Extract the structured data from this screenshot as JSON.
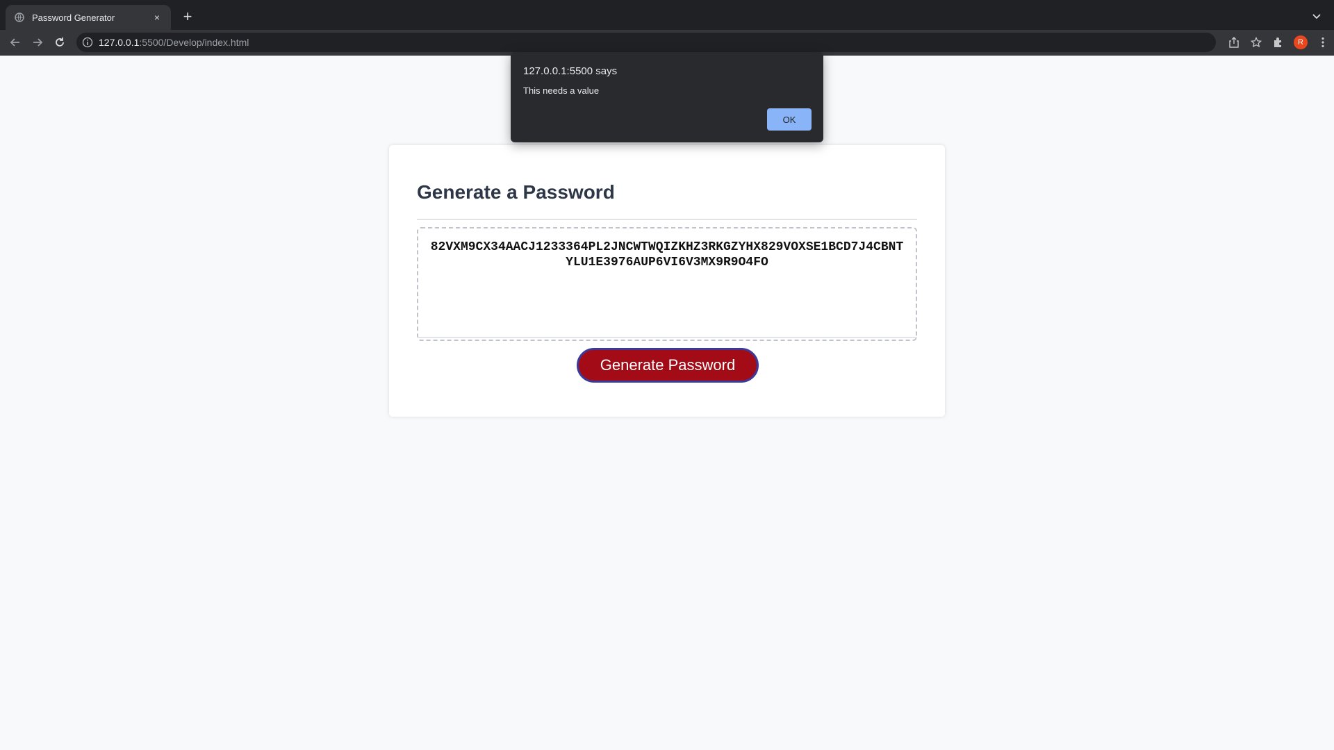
{
  "browser": {
    "tab": {
      "title": "Password Generator",
      "close": "×"
    },
    "new_tab": "+",
    "url_host": "127.0.0.1",
    "url_rest": ":5500/Develop/index.html",
    "avatar_initial": "R"
  },
  "dialog": {
    "title": "127.0.0.1:5500 says",
    "message": "This needs a value",
    "ok_label": "OK",
    "ok_color": "#8ab4f8"
  },
  "card": {
    "heading": "Generate a Password",
    "password": "82VXM9CX34AACJ1233364PL2JNCWTWQIZKHZ3RKGZYHX829VOXSE1BCD7J4CBNTYLU1E3976AUP6VI6V3MX9R9O4FO",
    "button_label": "Generate Password",
    "button_color": "#a30b16"
  },
  "icons": {
    "favicon": "globe-icon",
    "back": "back-arrow-icon",
    "forward": "forward-arrow-icon",
    "reload": "reload-icon",
    "info": "info-icon",
    "share": "share-icon",
    "bookmark": "star-icon",
    "extensions": "puzzle-icon",
    "menu": "kebab-menu-icon",
    "tab_search": "chevron-down-icon"
  }
}
